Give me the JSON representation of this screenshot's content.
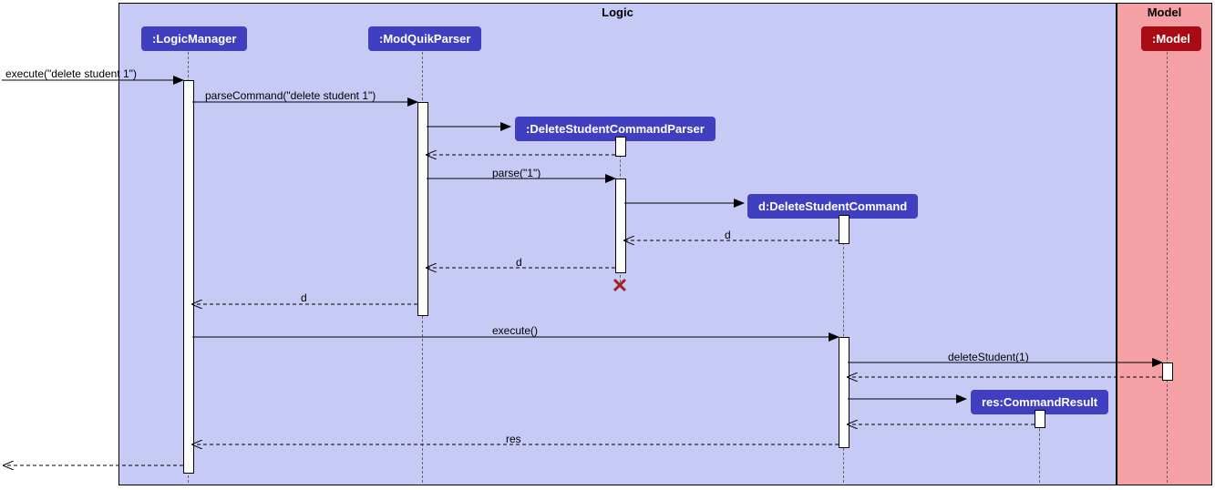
{
  "regions": {
    "logic": {
      "label": "Logic",
      "bg": "#c6caf4"
    },
    "model": {
      "label": "Model",
      "bg": "#f5a0a5"
    }
  },
  "colors": {
    "logicBox": "#3f3fbf",
    "modelBox": "#a80b13"
  },
  "participants": {
    "logicManager": ":LogicManager",
    "modQuikParser": ":ModQuikParser",
    "deleteStudentCommandParser": ":DeleteStudentCommandParser",
    "deleteStudentCommand": "d:DeleteStudentCommand",
    "commandResult": "res:CommandResult",
    "model": ":Model"
  },
  "messages": {
    "execute": "execute(\"delete student 1\")",
    "parseCommand": "parseCommand(\"delete student 1\")",
    "parse": "parse(\"1\")",
    "d1": "d",
    "d2": "d",
    "d3": "d",
    "execute2": "execute()",
    "deleteStudent": "deleteStudent(1)",
    "res": "res"
  }
}
